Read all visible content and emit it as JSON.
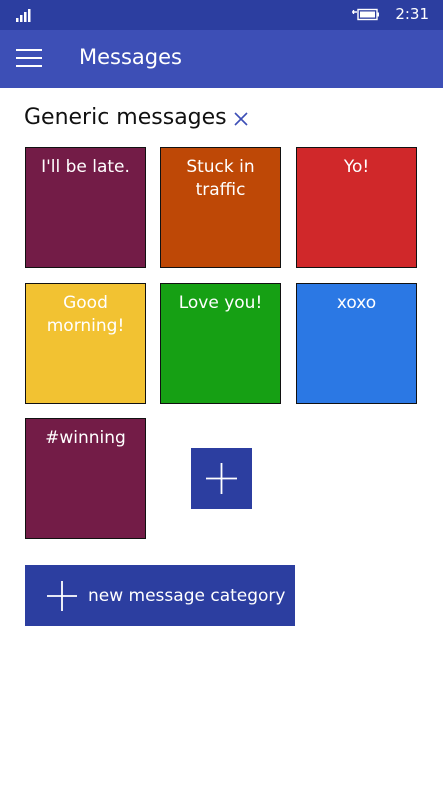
{
  "status": {
    "time": "2:31"
  },
  "app_bar": {
    "title": "Messages"
  },
  "section": {
    "title": "Generic messages"
  },
  "tiles": [
    {
      "label": "I'll be late.",
      "color": "#731c47"
    },
    {
      "label": "Stuck in traffic",
      "color": "#be4806"
    },
    {
      "label": "Yo!",
      "color": "#d0282a"
    },
    {
      "label": "Good morning!",
      "color": "#f2c232"
    },
    {
      "label": "Love you!",
      "color": "#16a014"
    },
    {
      "label": "xoxo",
      "color": "#2b78e4"
    },
    {
      "label": "#winning",
      "color": "#731c47"
    }
  ],
  "new_category": {
    "label": "new message category"
  },
  "colors": {
    "accent": "#2c3ea0",
    "app_bar": "#3d4fb6"
  }
}
